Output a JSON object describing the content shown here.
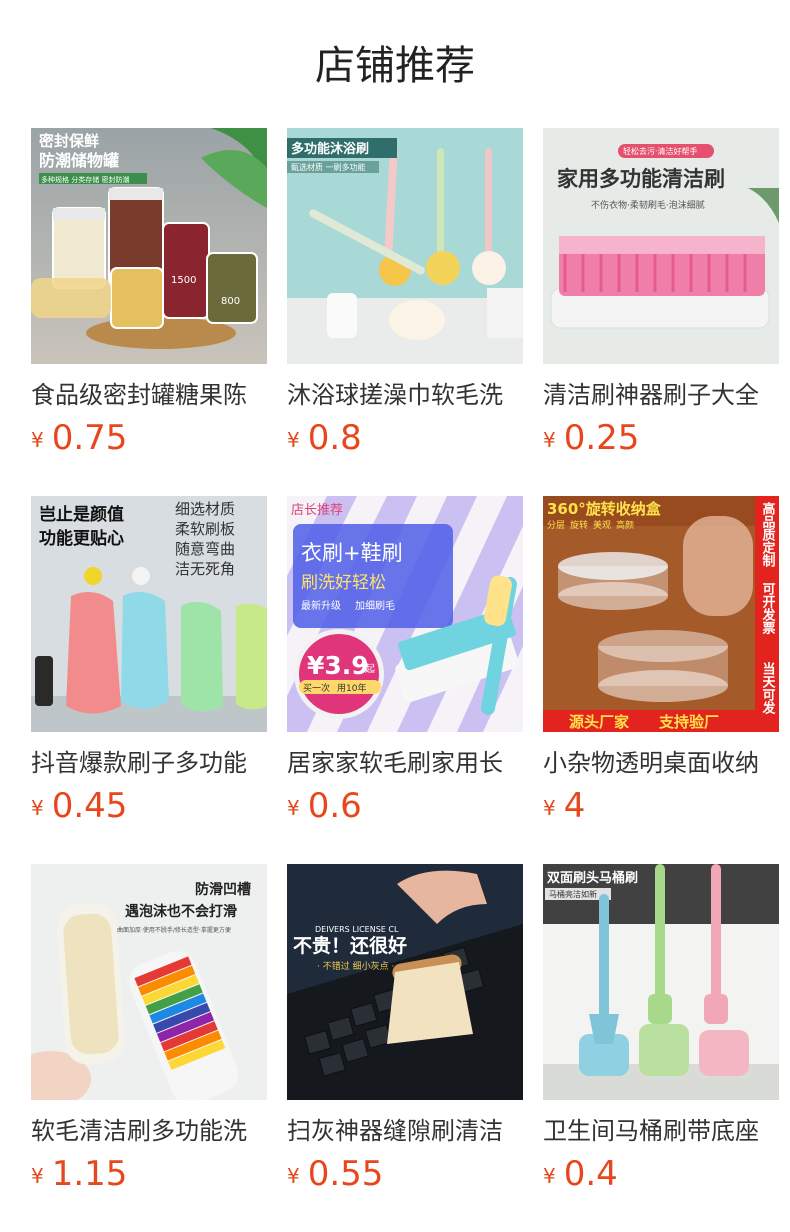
{
  "page": {
    "title": "店铺推荐"
  },
  "currency_symbol": "¥",
  "colors": {
    "price": "#e8471d",
    "title": "#222222"
  },
  "products": [
    {
      "name": "食品级密封罐糖果陈",
      "price": "0.75",
      "image_text": [
        "密封保鲜",
        "防潮储物罐",
        "多种规格 分类存储 密封防潮",
        "1500",
        "800"
      ]
    },
    {
      "name": "沐浴球搓澡巾软毛洗",
      "price": "0.8",
      "image_text": [
        "多功能沐浴刷",
        "甄选材质 一刷多功能"
      ]
    },
    {
      "name": "清洁刷神器刷子大全",
      "price": "0.25",
      "image_text": [
        "轻松去污·清洁好帮手",
        "家用多功能清洁刷",
        "不伤衣物·柔韧刷毛·泡沫细腻"
      ]
    },
    {
      "name": "抖音爆款刷子多功能",
      "price": "0.45",
      "image_text": [
        "岂止是颜值",
        "功能更贴心",
        "细选材质",
        "柔软刷板",
        "随意弯曲",
        "洁无死角"
      ]
    },
    {
      "name": "居家家软毛刷家用长",
      "price": "0.6",
      "image_text": [
        "店长推荐",
        "衣刷+鞋刷",
        "刷洗好轻松",
        "最新升级",
        "加细刷毛",
        "¥3.9",
        "起",
        "买一次",
        "用10年"
      ]
    },
    {
      "name": "小杂物透明桌面收纳",
      "price": "4",
      "image_text": [
        "360°旋转收纳盒",
        "分层",
        "旋转",
        "美观",
        "高颜",
        "高品质定制",
        "可开发票",
        "当天可发",
        "源头厂家",
        "支持验厂"
      ]
    },
    {
      "name": "软毛清洁刷多功能洗",
      "price": "1.15",
      "image_text": [
        "防滑凹槽",
        "遇泡沫也不会打滑",
        "曲面加厚·使用不脱手/修长造型·拿握更方便"
      ]
    },
    {
      "name": "扫灰神器缝隙刷清洁",
      "price": "0.55",
      "image_text": [
        "DEIVERS LICENSE CL",
        "不贵！还很好",
        "· 不错过 细小灰点 ·"
      ]
    },
    {
      "name": "卫生间马桶刷带底座",
      "price": "0.4",
      "image_text": [
        "双面刷头马桶刷",
        "马桶亮洁如新"
      ]
    }
  ]
}
